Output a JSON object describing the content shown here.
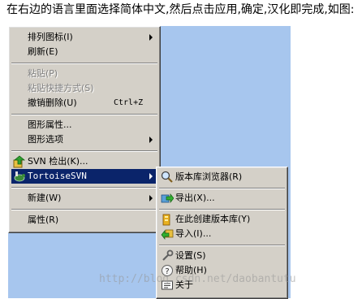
{
  "caption": "在右边的语言里面选择简体中文,然后点击应用,确定,汉化即完成,如图:",
  "menu": {
    "arrange_icons": "排列图标(I)",
    "refresh": "刷新(E)",
    "paste": "粘贴(P)",
    "paste_shortcut": "粘贴快捷方式(S)",
    "undo_delete": "撤销删除(U)",
    "undo_delete_shortcut": "Ctrl+Z",
    "graphics_properties": "图形属性...",
    "graphics_options": "图形选项",
    "svn_checkout": "SVN 检出(K)...",
    "tortoisesvn": "TortoiseSVN",
    "new": "新建(W)",
    "properties": "属性(R)"
  },
  "submenu": {
    "repo_browser": "版本库浏览器(R)",
    "export": "导出(X)...",
    "create_repo_here": "在此创建版本库(Y)",
    "import": "导入(I)...",
    "settings": "设置(S)",
    "help": "帮助(H)",
    "about": "关于"
  },
  "watermark": "http://blog.csdn.net/daobantutu",
  "colors": {
    "menu_bg": "#d4d0c8",
    "highlight": "#0a246a",
    "desktop": "#a7c6ee"
  }
}
